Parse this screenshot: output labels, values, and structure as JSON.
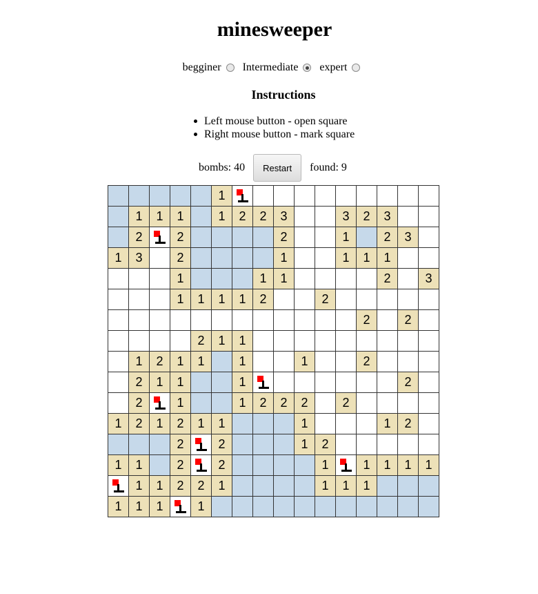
{
  "title": "minesweeper",
  "levels": [
    {
      "label": "begginer",
      "checked": false
    },
    {
      "label": "Intermediate",
      "checked": true
    },
    {
      "label": "expert",
      "checked": false
    }
  ],
  "instructions": {
    "title": "Instructions",
    "items": [
      "Left mouse button - open square",
      "Right mouse button - mark square"
    ]
  },
  "status": {
    "bombs_label": "bombs: 40",
    "restart_label": "Restart",
    "found_label": "found: 9"
  },
  "colors": {
    "empty_revealed": "#c6d9ea",
    "number_revealed": "#ede1b8",
    "unrevealed": "#ffffff",
    "flag": "#ff0000"
  },
  "legend": {
    "E": "revealed-empty",
    "U": "unrevealed",
    "F": "flagged",
    "1-8": "revealed-number"
  },
  "board": [
    [
      "E",
      "E",
      "E",
      "E",
      "E",
      "1",
      "F",
      "U",
      "U",
      "U",
      "U",
      "U",
      "U",
      "U",
      "U",
      "U"
    ],
    [
      "E",
      "1",
      "1",
      "1",
      "E",
      "1",
      "2",
      "2",
      "3",
      "U",
      "U",
      "3",
      "2",
      "3",
      "U",
      "U"
    ],
    [
      "E",
      "2",
      "F",
      "2",
      "E",
      "E",
      "E",
      "E",
      "2",
      "U",
      "U",
      "1",
      "E",
      "2",
      "3",
      "U"
    ],
    [
      "1",
      "3",
      "U",
      "2",
      "E",
      "E",
      "E",
      "E",
      "1",
      "U",
      "U",
      "1",
      "1",
      "1",
      "U",
      "U"
    ],
    [
      "U",
      "U",
      "U",
      "1",
      "E",
      "E",
      "E",
      "1",
      "1",
      "U",
      "U",
      "U",
      "U",
      "2",
      "U",
      "3"
    ],
    [
      "U",
      "U",
      "U",
      "1",
      "1",
      "1",
      "1",
      "2",
      "U",
      "U",
      "2",
      "U",
      "U",
      "U",
      "U",
      "U"
    ],
    [
      "U",
      "U",
      "U",
      "U",
      "U",
      "U",
      "U",
      "U",
      "U",
      "U",
      "U",
      "U",
      "2",
      "U",
      "2",
      "U"
    ],
    [
      "U",
      "U",
      "U",
      "U",
      "2",
      "1",
      "1",
      "U",
      "U",
      "U",
      "U",
      "U",
      "U",
      "U",
      "U",
      "U"
    ],
    [
      "U",
      "1",
      "2",
      "1",
      "1",
      "E",
      "1",
      "U",
      "U",
      "1",
      "U",
      "U",
      "2",
      "U",
      "U",
      "U"
    ],
    [
      "U",
      "2",
      "1",
      "1",
      "E",
      "E",
      "1",
      "F",
      "U",
      "U",
      "U",
      "U",
      "U",
      "U",
      "2",
      "U"
    ],
    [
      "U",
      "2",
      "F",
      "1",
      "E",
      "E",
      "1",
      "2",
      "2",
      "2",
      "U",
      "2",
      "U",
      "U",
      "U",
      "U"
    ],
    [
      "1",
      "2",
      "1",
      "2",
      "1",
      "1",
      "E",
      "E",
      "E",
      "1",
      "U",
      "U",
      "U",
      "1",
      "2",
      "U"
    ],
    [
      "E",
      "E",
      "E",
      "2",
      "F",
      "2",
      "E",
      "E",
      "E",
      "1",
      "2",
      "U",
      "U",
      "U",
      "U",
      "U"
    ],
    [
      "1",
      "1",
      "E",
      "2",
      "F",
      "2",
      "E",
      "E",
      "E",
      "E",
      "1",
      "F",
      "1",
      "1",
      "1",
      "1"
    ],
    [
      "F",
      "1",
      "1",
      "2",
      "2",
      "1",
      "E",
      "E",
      "E",
      "E",
      "1",
      "1",
      "1",
      "E",
      "E",
      "E"
    ],
    [
      "1",
      "1",
      "1",
      "F",
      "1",
      "E",
      "E",
      "E",
      "E",
      "E",
      "E",
      "E",
      "E",
      "E",
      "E",
      "E"
    ]
  ]
}
